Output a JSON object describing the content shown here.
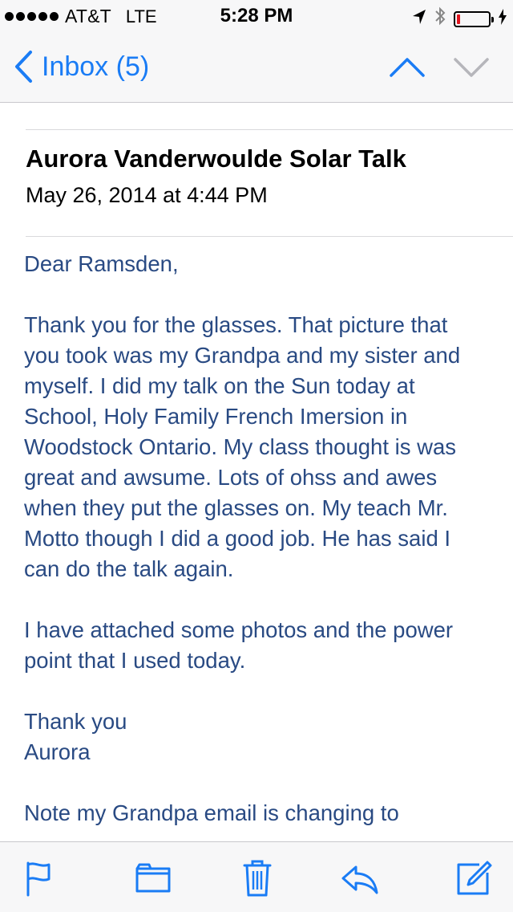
{
  "status_bar": {
    "carrier": "AT&T",
    "network": "LTE",
    "time": "5:28 PM"
  },
  "nav": {
    "back_label": "Inbox (5)"
  },
  "email": {
    "sender": "Aurora Vanderwoulde Solar Talk",
    "datetime": "May 26, 2014 at 4:44 PM",
    "greeting": "Dear Ramsden,",
    "para1": "Thank you for the glasses. That picture that you took was my Grandpa and my sister and myself. I did my talk on the Sun today at School, Holy Family French Imersion in Woodstock Ontario.  My class thought is was great and awsume. Lots of ohss  and awes when they put the glasses on. My teach Mr. Motto though I did a good job. He has said I can do the talk again.",
    "para2": "I have attached some photos and the power point that I used today.",
    "signoff": "Thank you\nAurora",
    "note": "Note my  Grandpa email is changing to"
  },
  "colors": {
    "accent": "#1a7cf5",
    "body_text": "#294a83",
    "battery_low": "#e0141e"
  },
  "toolbar": {
    "icons": [
      "flag-icon",
      "folder-icon",
      "trash-icon",
      "reply-icon",
      "compose-icon"
    ]
  }
}
